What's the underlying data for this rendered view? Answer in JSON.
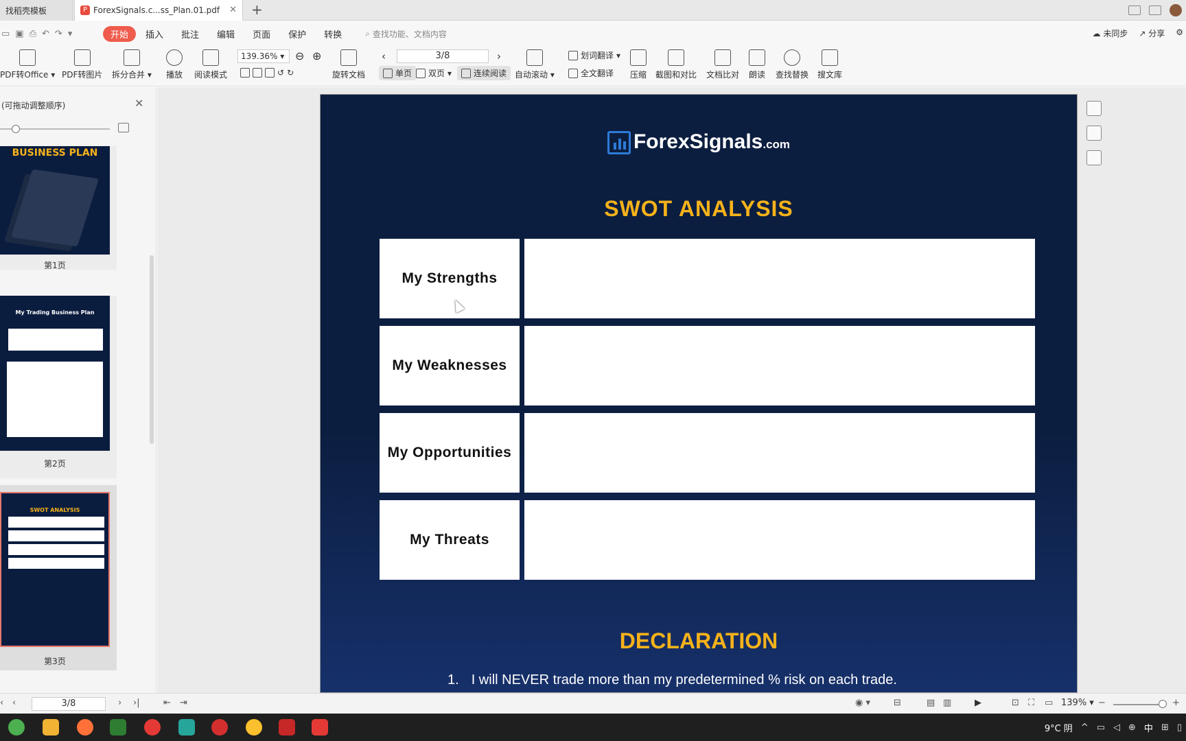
{
  "tabs": {
    "inactive_label": "找稻壳模板",
    "active_label": "ForexSignals.c...ss_Plan.01.pdf",
    "new_tab": "+"
  },
  "menu": {
    "items": [
      "开始",
      "插入",
      "批注",
      "编辑",
      "页面",
      "保护",
      "转换"
    ],
    "search_placeholder": "查找功能、文档内容",
    "sync_label": "未同步",
    "share_label": "分享"
  },
  "ribbon": {
    "pdf_to_office": "PDF转Office",
    "pdf_to_image": "PDF转图片",
    "split_merge": "拆分合并",
    "play": "播放",
    "read_mode": "阅读模式",
    "zoom_value": "139.36%",
    "rotate_doc": "旋转文档",
    "page_value": "3/8",
    "single_page": "单页",
    "double_page": "双页",
    "continuous_read": "连续阅读",
    "auto_scroll": "自动滚动",
    "word_translate": "划词翻译",
    "full_translate": "全文翻译",
    "compress": "压缩",
    "screenshot_compare": "截图和对比",
    "doc_compare": "文档比对",
    "read_aloud": "朗读",
    "find_replace": "查找替换",
    "search_library": "搜文库"
  },
  "sidebar": {
    "title": "(可拖动调整顺序)",
    "thumbnails": [
      {
        "label": "第1页",
        "heading": "BUSINESS PLAN"
      },
      {
        "label": "第2页",
        "heading": "My Trading Business Plan"
      },
      {
        "label": "第3页",
        "heading": "SWOT ANALYSIS"
      }
    ]
  },
  "document": {
    "logo_main": "ForexSignals",
    "logo_suffix": ".com",
    "swot_title": "SWOT ANALYSIS",
    "rows": [
      "My Strengths",
      "My Weaknesses",
      "My Opportunities",
      "My Threats"
    ],
    "declaration_title": "DECLARATION",
    "declaration_item_num": "1.",
    "declaration_item_text": "I will NEVER trade more than my predetermined % risk on each trade."
  },
  "statusbar": {
    "page_value": "3/8",
    "zoom_label": "139%"
  },
  "tray": {
    "weather": "9°C 阴",
    "ime": "中"
  },
  "colors": {
    "accent_red": "#ef5b4c",
    "page_navy": "#0c1e40",
    "title_gold": "#f6b21a",
    "logo_blue": "#2d7bd8"
  }
}
